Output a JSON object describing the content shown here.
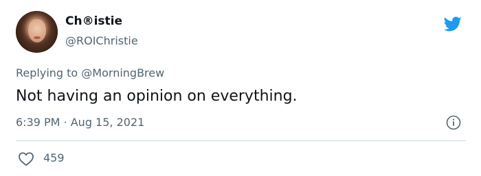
{
  "tweet": {
    "author": {
      "display_name": "Ch®istie",
      "handle": "@ROIChristie"
    },
    "reply_prefix": "Replying to ",
    "reply_to": "@MorningBrew",
    "text": "Not having an opinion on everything.",
    "timestamp": "6:39 PM · Aug 15, 2021",
    "likes": "459"
  },
  "icons": {
    "brand": "twitter-bird-icon",
    "info": "info-icon",
    "like": "heart-icon"
  },
  "colors": {
    "brand_blue": "#1d9bf0",
    "text_primary": "#0f1419",
    "text_secondary": "#536471",
    "divider": "#cfd9de"
  }
}
